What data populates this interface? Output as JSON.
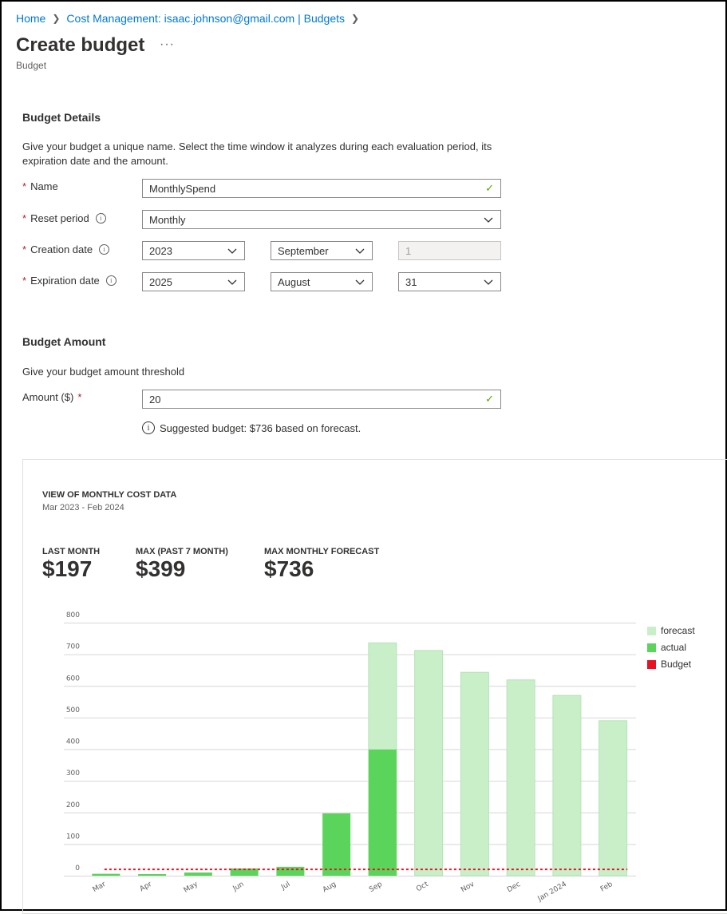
{
  "breadcrumb": {
    "home": "Home",
    "cost_mgmt": "Cost Management: isaac.johnson@gmail.com | Budgets"
  },
  "header": {
    "title": "Create budget",
    "more": "···",
    "subtitle": "Budget"
  },
  "details": {
    "heading": "Budget Details",
    "description": "Give your budget a unique name. Select the time window it analyzes during each evaluation period, its expiration date and the amount.",
    "name_label": "Name",
    "name_value": "MonthlySpend",
    "reset_label": "Reset period",
    "reset_value": "Monthly",
    "creation_label": "Creation date",
    "creation_year": "2023",
    "creation_month": "September",
    "creation_day": "1",
    "expiration_label": "Expiration date",
    "expiration_year": "2025",
    "expiration_month": "August",
    "expiration_day": "31"
  },
  "amount": {
    "heading": "Budget Amount",
    "description": "Give your budget amount threshold",
    "label": "Amount ($)",
    "value": "20",
    "suggestion": "Suggested budget: $736 based on forecast."
  },
  "panel": {
    "title": "VIEW OF MONTHLY COST DATA",
    "range": "Mar 2023 - Feb 2024",
    "kpis": [
      {
        "label": "LAST MONTH",
        "value": "$197"
      },
      {
        "label": "MAX (PAST 7 MONTH)",
        "value": "$399"
      },
      {
        "label": "MAX MONTHLY FORECAST",
        "value": "$736"
      }
    ]
  },
  "colors": {
    "forecast": "#c9efc9",
    "actual": "#5ad45a",
    "budget": "#e81123",
    "link": "#0078d4"
  },
  "chart_data": {
    "type": "bar",
    "categories": [
      "Mar",
      "Apr",
      "May",
      "Jun",
      "Jul",
      "Aug",
      "Sep",
      "Oct",
      "Nov",
      "Dec",
      "Jan 2024",
      "Feb"
    ],
    "series": [
      {
        "name": "forecast",
        "values": [
          null,
          null,
          null,
          null,
          null,
          null,
          736,
          712,
          643,
          619,
          570,
          490
        ]
      },
      {
        "name": "actual",
        "values": [
          6,
          5,
          10,
          23,
          28,
          197,
          399,
          null,
          null,
          null,
          null,
          null
        ]
      },
      {
        "name": "Budget",
        "values": [
          20,
          20,
          20,
          20,
          20,
          20,
          20,
          20,
          20,
          20,
          20,
          20
        ]
      }
    ],
    "yticks": [
      0,
      100,
      200,
      300,
      400,
      500,
      600,
      700,
      800
    ],
    "ylim": [
      0,
      800
    ],
    "grid": true,
    "legend_position": "right"
  }
}
